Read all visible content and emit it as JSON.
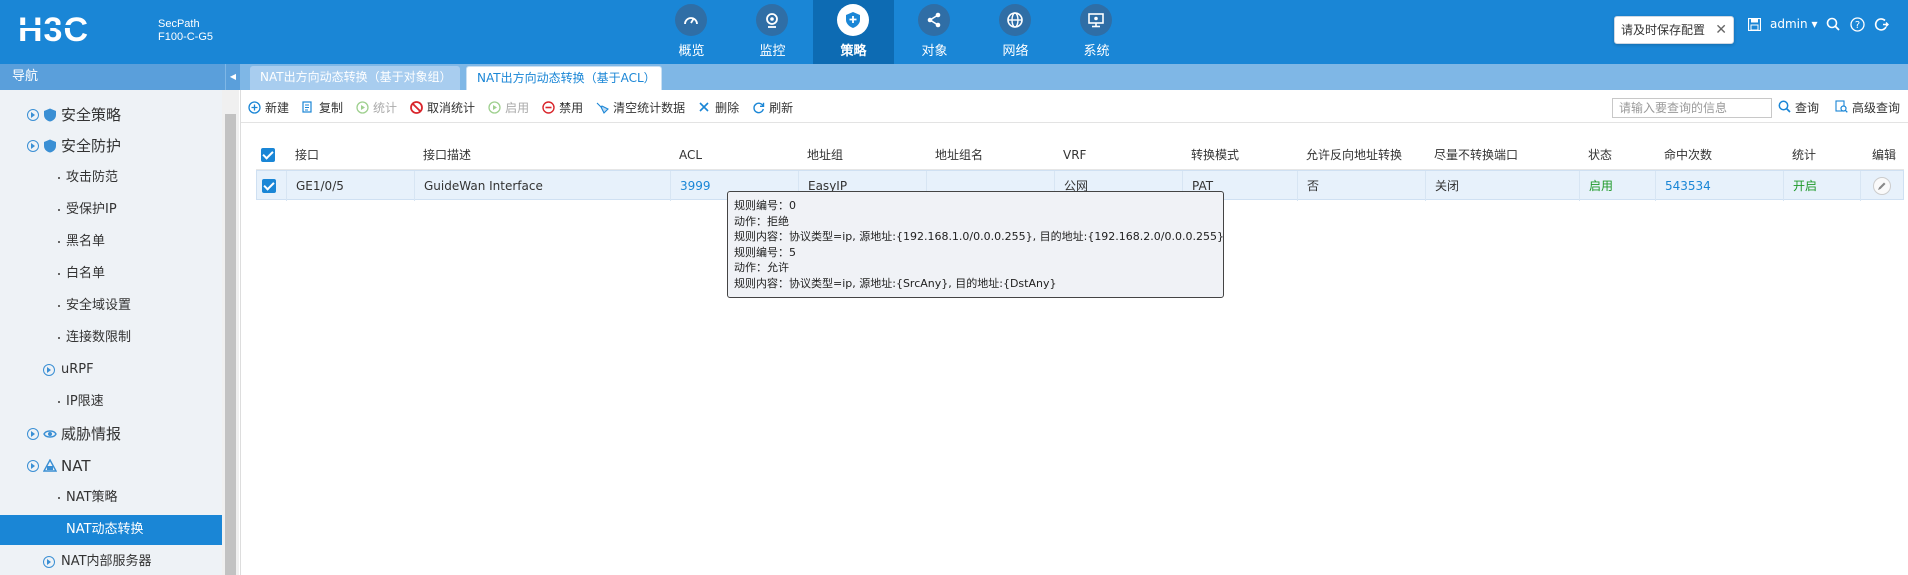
{
  "header": {
    "brand_line1": "SecPath",
    "brand_line2": "F100-C-G5",
    "nav": [
      {
        "label": "概览",
        "icon": "gauge-icon"
      },
      {
        "label": "监控",
        "icon": "webcam-icon"
      },
      {
        "label": "策略",
        "icon": "shield-icon",
        "active": true
      },
      {
        "label": "对象",
        "icon": "share-icon"
      },
      {
        "label": "网络",
        "icon": "globe-icon"
      },
      {
        "label": "系统",
        "icon": "monitor-icon"
      }
    ],
    "save_tip": "请及时保存配置",
    "user": "admin"
  },
  "subbar": {
    "nav_label": "导航",
    "tabs": [
      {
        "label": "NAT出方向动态转换（基于对象组）"
      },
      {
        "label": "NAT出方向动态转换（基于ACL）",
        "active": true
      }
    ]
  },
  "sidebar": {
    "items": [
      {
        "label": "安全策略",
        "level": 1
      },
      {
        "label": "安全防护",
        "level": 1
      },
      {
        "label": "攻击防范",
        "level": 2
      },
      {
        "label": "受保护IP",
        "level": 2
      },
      {
        "label": "黑名单",
        "level": 2
      },
      {
        "label": "白名单",
        "level": 2
      },
      {
        "label": "安全域设置",
        "level": 2
      },
      {
        "label": "连接数限制",
        "level": 2
      },
      {
        "label": "uRPF",
        "level": 2
      },
      {
        "label": "IP限速",
        "level": 2
      },
      {
        "label": "威胁情报",
        "level": 1
      },
      {
        "label": "NAT",
        "level": 1
      },
      {
        "label": "NAT策略",
        "level": 2
      },
      {
        "label": "NAT动态转换",
        "level": 2,
        "active": true
      },
      {
        "label": "NAT内部服务器",
        "level": 2
      }
    ]
  },
  "toolbar": {
    "new": "新建",
    "copy": "复制",
    "stats": "统计",
    "cancel_stats": "取消统计",
    "enable": "启用",
    "disable": "禁用",
    "clear_stats": "清空统计数据",
    "delete": "删除",
    "refresh": "刷新",
    "search_placeholder": "请输入要查询的信息",
    "search": "查询",
    "advanced_search": "高级查询"
  },
  "table": {
    "columns": [
      "接口",
      "接口描述",
      "ACL",
      "地址组",
      "地址组名",
      "VRF",
      "转换模式",
      "允许反向地址转换",
      "尽量不转换端口",
      "状态",
      "命中次数",
      "统计",
      "编辑"
    ],
    "rows": [
      {
        "interface": "GE1/0/5",
        "description": "GuideWan Interface",
        "acl": "3999",
        "address_group": "EasyIP",
        "address_group_name": "",
        "vrf": "公网",
        "mode": "PAT",
        "reverse": "否",
        "no_port": "关闭",
        "status": "启用",
        "hits": "543534",
        "stats": "开启"
      }
    ]
  },
  "tooltip": {
    "lines": [
      "规则编号：0",
      "动作：拒绝",
      "规则内容：协议类型=ip, 源地址:{192.168.1.0/0.0.0.255}, 目的地址:{192.168.2.0/0.0.0.255}",
      "规则编号：5",
      "动作：允许",
      "规则内容：协议类型=ip, 源地址:{SrcAny}, 目的地址:{DstAny}"
    ]
  },
  "colors": {
    "header_blue": "#1a86d6",
    "active_nav": "#0d6bb3",
    "link": "#1a86d6",
    "green": "#1f9a2a"
  }
}
